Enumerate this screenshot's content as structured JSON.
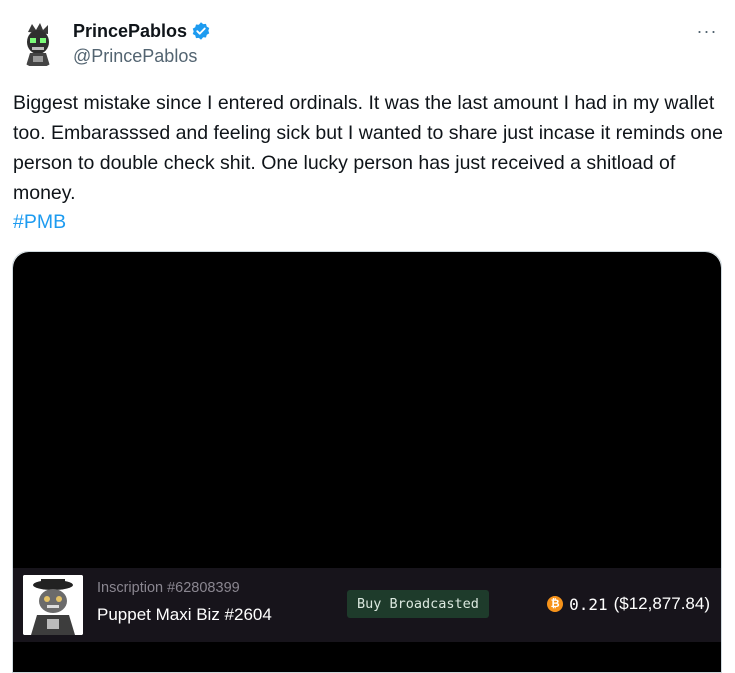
{
  "post": {
    "author_name": "PrincePablos",
    "author_handle": "@PrincePablos",
    "verified": true,
    "more_label": "···",
    "text": "Biggest mistake since I entered ordinals. It was the last amount I had in my wallet too. Embarasssed and feeling sick but I wanted to share just incase it reminds one person to double check shit. One lucky person has just received a shitload of money.",
    "hashtag": "#PMB"
  },
  "media": {
    "inscription_label": "Inscription #62808399",
    "item_title": "Puppet Maxi Biz #2604",
    "status_button": "Buy Broadcasted",
    "price_btc": "0.21",
    "price_usd": "($12,877.84)",
    "currency_icon": "bitcoin-icon"
  },
  "colors": {
    "link": "#1d9bf0",
    "verified": "#1d9bf0",
    "media_bg": "#000000",
    "card_bg": "#17141b",
    "status_bg": "#1e3b2b",
    "bitcoin": "#f7931a"
  }
}
